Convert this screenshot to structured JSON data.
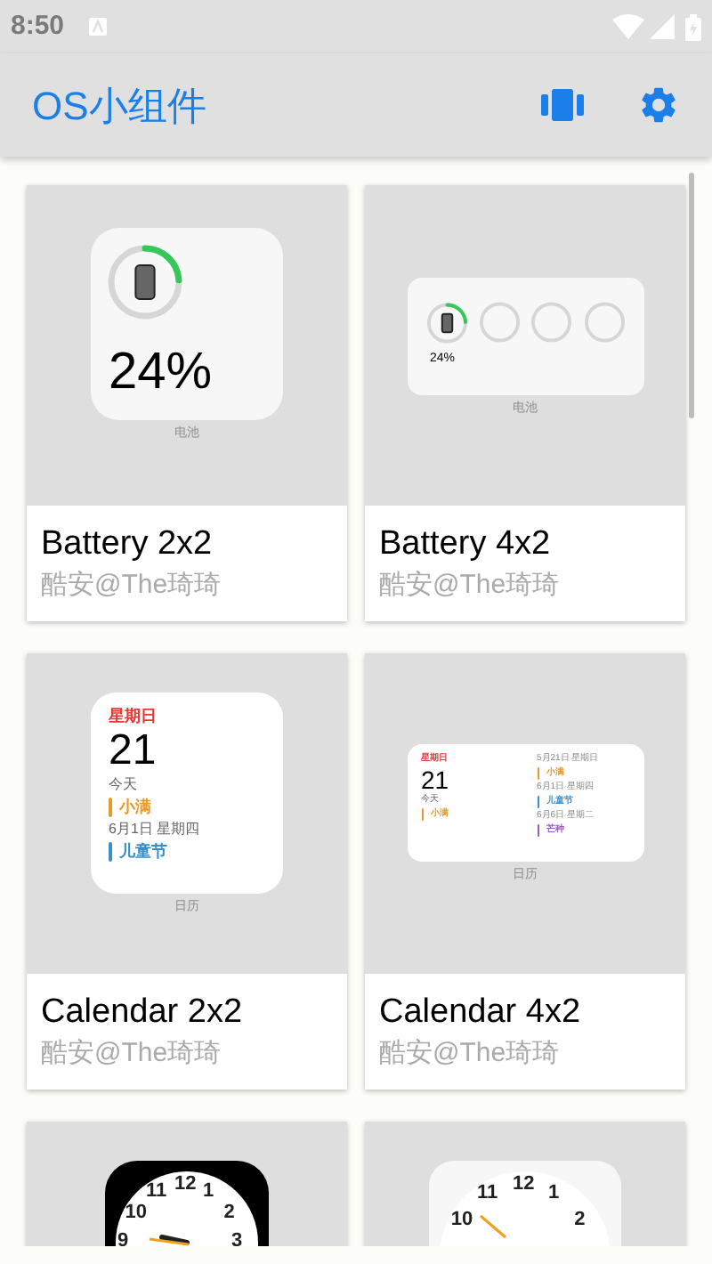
{
  "status_bar": {
    "time": "8:50"
  },
  "app_bar": {
    "title": "OS小组件"
  },
  "widgets": [
    {
      "kind": "battery",
      "percent": "24%",
      "caption": "电池",
      "title": "Battery 2x2",
      "author": "酷安@The琦琦"
    },
    {
      "kind": "battery",
      "percent": "24%",
      "caption": "电池",
      "title": "Battery 4x2",
      "author": "酷安@The琦琦"
    },
    {
      "kind": "calendar",
      "weekday": "星期日",
      "day": "21",
      "today": "今天",
      "caption": "日历",
      "title": "Calendar 2x2",
      "author": "酷安@The琦琦",
      "events": [
        {
          "name": "小满",
          "color": "#e69a28"
        },
        {
          "date": "6月1日 星期四",
          "name": "儿童节",
          "color": "#3a8fc8"
        }
      ]
    },
    {
      "kind": "calendar",
      "weekday": "星期日",
      "day": "21",
      "today": "今天",
      "caption": "日历",
      "title": "Calendar 4x2",
      "author": "酷安@The琦琦",
      "today_event": {
        "name": "小满",
        "color": "#e69a28"
      },
      "events": [
        {
          "date": "5月21日 星期日",
          "name": "小满",
          "color": "#e69a28"
        },
        {
          "date": "6月1日 星期四",
          "name": "儿童节",
          "color": "#3a8fc8"
        },
        {
          "date": "6月6日 星期二",
          "name": "芒种",
          "color": "#9a5ab8"
        }
      ]
    },
    {
      "kind": "darkclock",
      "numerals": [
        "11",
        "12",
        "1",
        "10",
        "2",
        "9",
        "3"
      ]
    },
    {
      "kind": "clock",
      "numerals": [
        "11",
        "12",
        "1",
        "10",
        "2"
      ]
    }
  ]
}
